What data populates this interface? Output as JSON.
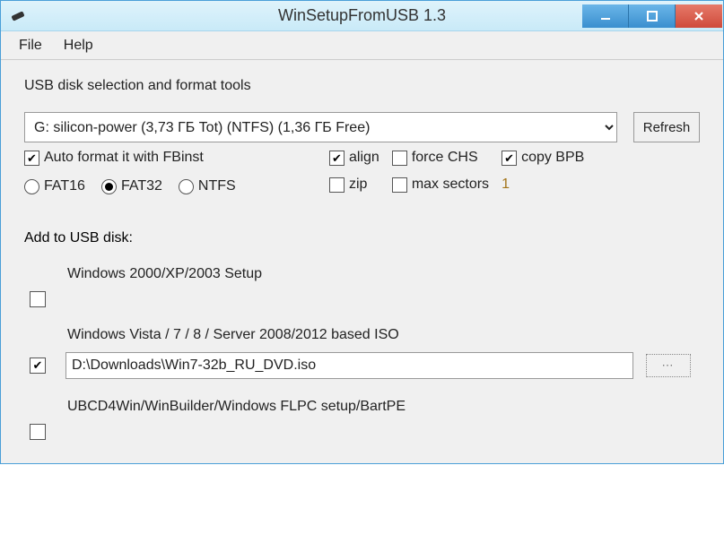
{
  "window": {
    "title": "WinSetupFromUSB 1.3"
  },
  "menu": {
    "file": "File",
    "help": "Help"
  },
  "disk": {
    "section_label": "USB disk selection and format tools",
    "selected": "G: silicon-power (3,73 ГБ Tot) (NTFS) (1,36 ГБ Free)",
    "refresh": "Refresh"
  },
  "format": {
    "auto_format_label": "Auto format it with FBinst",
    "fs": {
      "fat16": "FAT16",
      "fat32": "FAT32",
      "ntfs": "NTFS"
    },
    "opts": {
      "align": "align",
      "force_chs": "force CHS",
      "copy_bpb": "copy BPB",
      "zip": "zip",
      "max_sectors": "max sectors",
      "max_sectors_value": "1"
    }
  },
  "add": {
    "header": "Add to USB disk:",
    "entry1": {
      "label": "Windows 2000/XP/2003 Setup"
    },
    "entry2": {
      "label": "Windows Vista / 7 / 8 / Server 2008/2012 based ISO",
      "path": "D:\\Downloads\\Win7-32b_RU_DVD.iso",
      "browse": "…"
    },
    "entry3": {
      "label": "UBCD4Win/WinBuilder/Windows FLPC setup/BartPE"
    }
  }
}
